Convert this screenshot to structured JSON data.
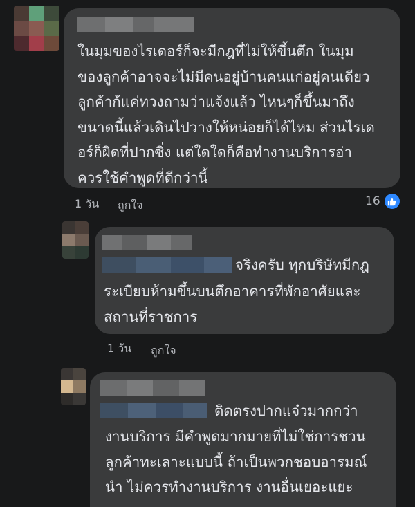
{
  "comments": [
    {
      "text": "ในมุมของไรเดอร์ก็จะมีกฎที่ไม่ให้ขึ้นตึก ในมุม\nของลูกค้าอาจจะไม่มีคนอยู่บ้านคนแก่อยู่คนเดียว\nลูกค้าก้แค่ทวงถามว่าแจ้งแล้ว ไหนๆก็ขึ้นมาถึง\nขนาดนี้แล้วเดินไปวางให้หน่อยก็ได้ไหม ส่วนไรเด\nอร์ก็ผิดที่ปากซิ่ง แต่ใดใดก็คือทำงานบริการอ่า\nควรใช้คำพูดที่ดีกว่านี้",
      "time": "1 วัน",
      "like_label": "ถูกใจ",
      "reaction_count": "16"
    },
    {
      "text_first": "จริงครับ ทุกบริษัทมีกฎ",
      "text_rest": "ระเบียบห้ามขึ้นบนตึกอาคารที่พักอาศัยและ\nสถานที่ราชการ",
      "time": "1 วัน",
      "like_label": "ถูกใจ"
    },
    {
      "text_first": "ติดตรงปากแจ๋วมากกว่า",
      "text_rest": "งานบริการ มีคำพูดมากมายที่ไม่ใช่การชวน\nลูกค้าทะเลาะแบบนี้ ถ้าเป็นพวกชอบอารมณ์\nนำ ไม่ควรทำงานบริการ งานอื่นเยอะแยะ"
    }
  ],
  "colors": {
    "background": "#18191a",
    "bubble": "#3a3b3c",
    "text": "#e4e6eb",
    "meta": "#b0b3b8",
    "like_blue": "#2d88ff"
  },
  "icons": {
    "reaction": "thumbs-up-icon"
  }
}
